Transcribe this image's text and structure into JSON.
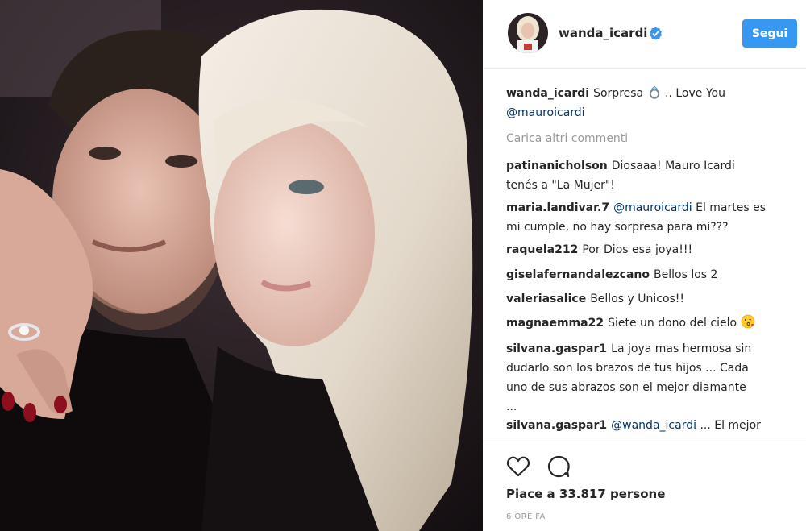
{
  "post": {
    "author": "wanda_icardi",
    "verified": true,
    "follow_label": "Segui",
    "caption": {
      "user": "wanda_icardi",
      "text_before": "Sorpresa",
      "text_after": ".. Love You",
      "mention": "@mauroicardi"
    },
    "load_more_label": "Carica altri commenti"
  },
  "comments": [
    {
      "user": "patinanicholson",
      "line1": "Diosaaa! Mauro Icardi",
      "line2": "tenés a \"La Mujer\"!"
    },
    {
      "user": "maria.landivar.7",
      "mention": "@mauroicardi",
      "line1": "El martes es",
      "line2": "mi cumple, no hay sorpresa para mi???"
    },
    {
      "user": "raquela212",
      "line1": "Por Dios esa joya!!!"
    },
    {
      "user": "giselafernandalezcano",
      "line1": "Bellos los 2"
    },
    {
      "user": "valeriasalice",
      "line1": "Bellos y Unicos!!"
    },
    {
      "user": "magnaemma22",
      "line1": "Siete un dono del cielo"
    },
    {
      "user": "silvana.gaspar1",
      "line1": "La joya mas hermosa sin",
      "line2": "dudarlo son los brazos de tus hijos ... Cada",
      "line3": "uno de sus abrazos son el mejor diamante",
      "line4": "..."
    },
    {
      "user": "silvana.gaspar1",
      "mention": "@wanda_icardi",
      "line1": "... El mejor"
    }
  ],
  "likes_label": "Piace a 33.817 persone",
  "time_label": "6 ORE FA",
  "icons": [
    "verified-badge-icon",
    "ring-emoji-icon",
    "kiss-emoji-icon",
    "heart-icon",
    "comment-icon"
  ],
  "colors": {
    "follow": "#3897f0",
    "mention": "#003569",
    "muted": "#999999"
  }
}
